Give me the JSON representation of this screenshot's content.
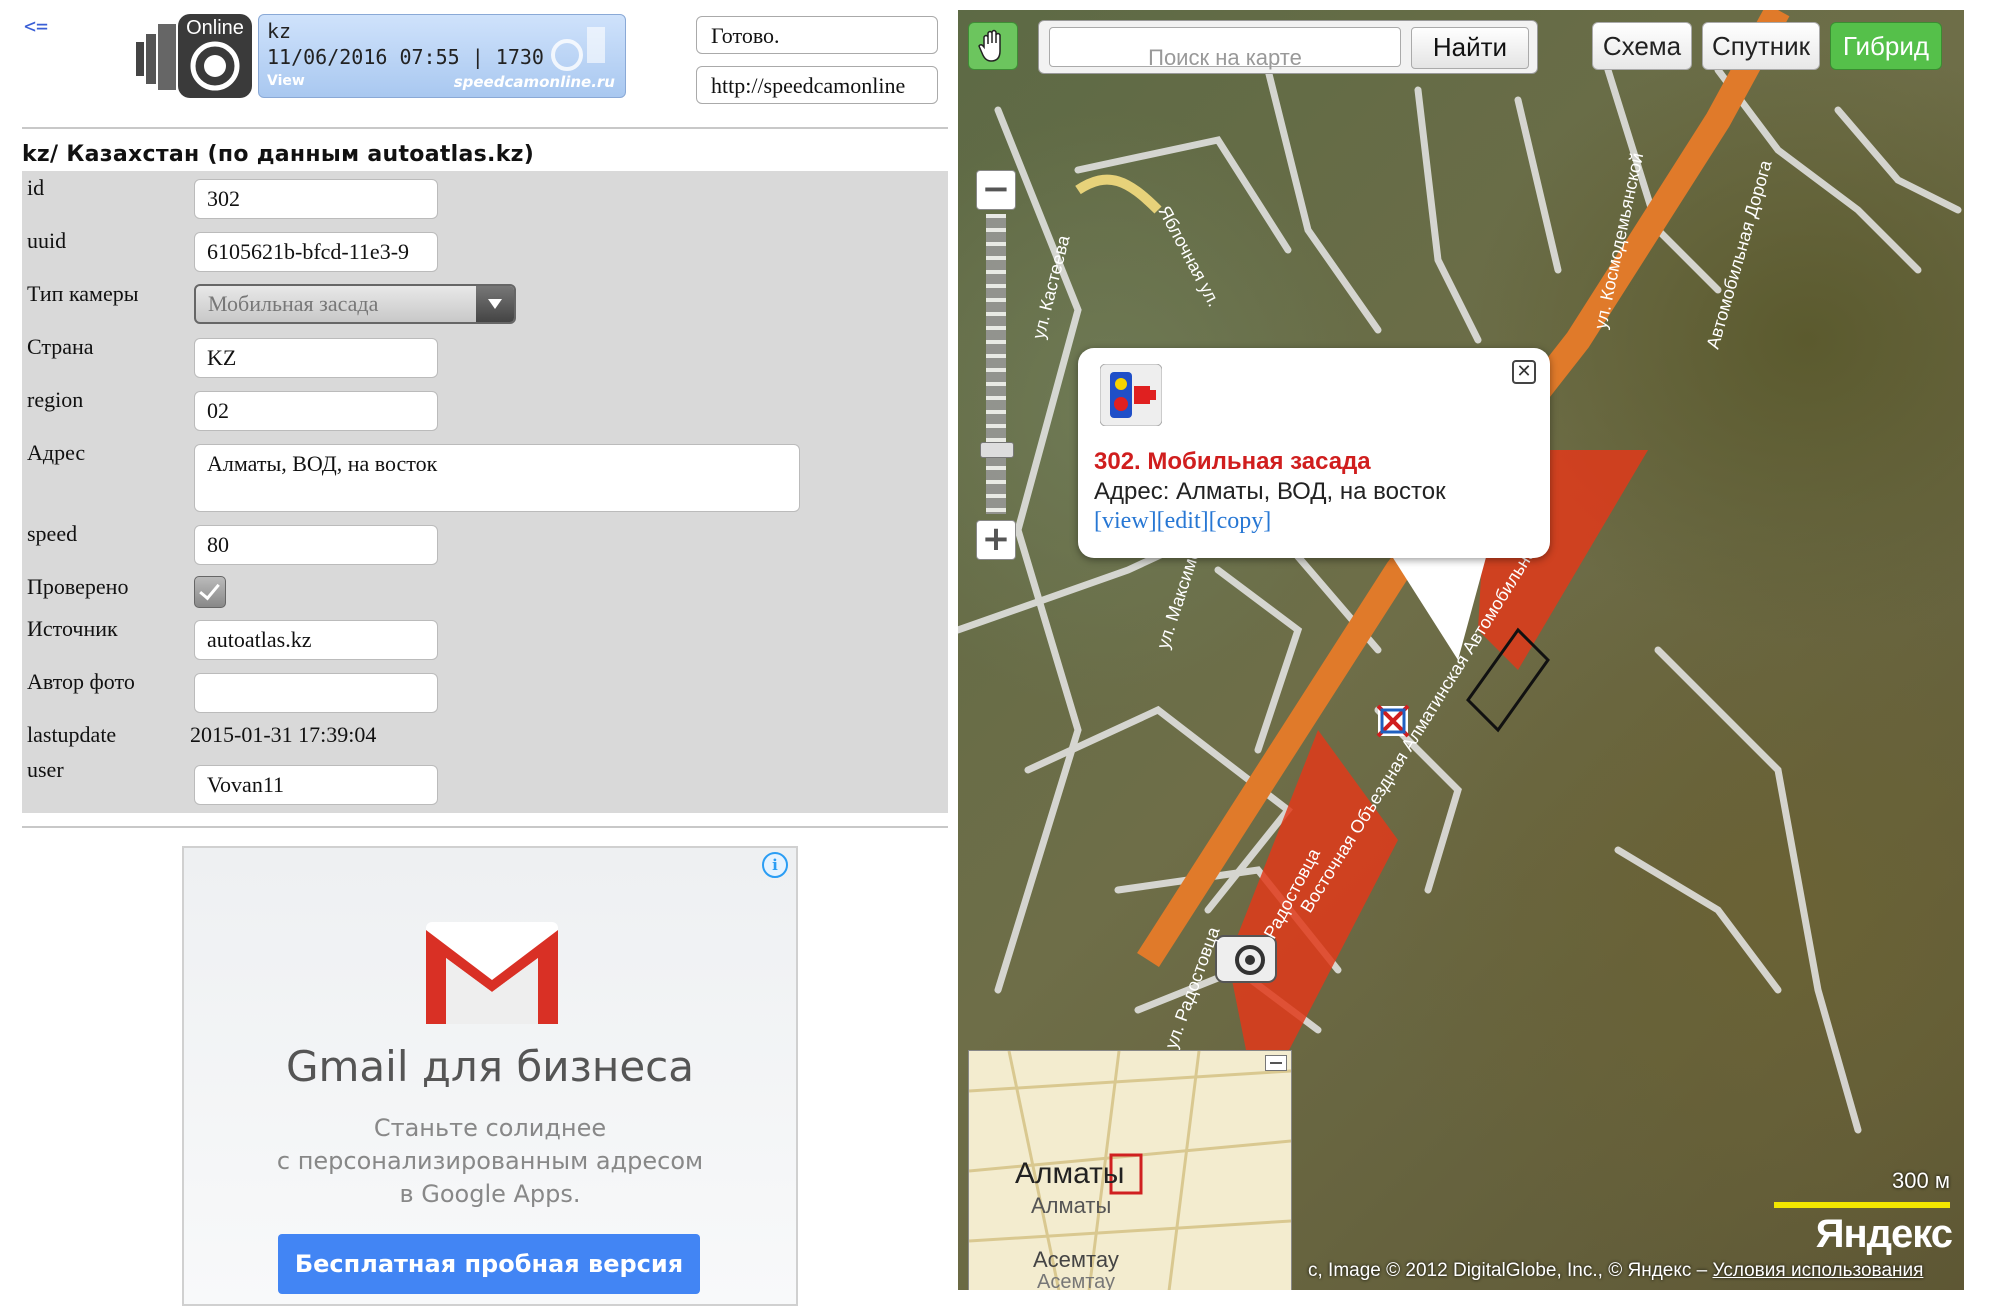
{
  "nav": {
    "back_link": "<="
  },
  "logo": {
    "text": "Online"
  },
  "ticker": {
    "line1": "kz",
    "line2": "11/06/2016 07:55 | 1730",
    "line3": "View",
    "site": "speedcamonline.ru"
  },
  "status_box": "Готово.",
  "url_box": "http://speedcamonline",
  "section_title": "kz/ Казахстан (по данным autoatlas.kz)",
  "form": {
    "id_label": "id",
    "id_value": "302",
    "uuid_label": "uuid",
    "uuid_value": "6105621b-bfcd-11e3-9",
    "type_label": "Тип камеры",
    "type_value": "Мобильная засада",
    "country_label": "Страна",
    "country_value": "KZ",
    "region_label": "region",
    "region_value": "02",
    "address_label": "Адрес",
    "address_value": "Алматы, ВОД, на восток",
    "speed_label": "speed",
    "speed_value": "80",
    "verified_label": "Проверено",
    "verified_checked": true,
    "source_label": "Источник",
    "source_value": "autoatlas.kz",
    "photo_author_label": "Автор фото",
    "photo_author_value": "",
    "lastupdate_label": "lastupdate",
    "lastupdate_value": "2015-01-31 17:39:04",
    "user_label": "user",
    "user_value": "Vovan11"
  },
  "ad": {
    "info_icon": "i",
    "title": "Gmail для бизнеса",
    "text_line1": "Станьте солиднее",
    "text_line2": "с персонализированным адресом",
    "text_line3": "в Google Apps.",
    "button": "Бесплатная пробная версия",
    "colors": {
      "button": "#4285f4",
      "logo_red": "#d93025"
    }
  },
  "map": {
    "search_placeholder": "Поиск на карте",
    "search_button": "Найти",
    "mode_scheme": "Схема",
    "mode_satellite": "Спутник",
    "mode_hybrid": "Гибрид",
    "zoom_minus": "−",
    "zoom_plus": "+",
    "balloon": {
      "title": "302. Мобильная засада",
      "address": "Адрес: Алматы, ВОД, на восток",
      "links": "[view][edit][copy]",
      "close": "✕"
    },
    "streets": {
      "s1": "ул. Кастеева",
      "s2": "Яблочная ул.",
      "s3": "ул. Космодемьянской",
      "s4": "Автомобильная Дорога",
      "s5": "ул. Максимова",
      "s6": "Восточная Объездная Алматинская Автомобильная",
      "s7": "ул. Радостовца",
      "s8": "Радостовца"
    },
    "minimap": {
      "city": "Алматы",
      "city_sub": "Алматы",
      "town": "Асемтау",
      "town_sub": "Асемтау"
    },
    "scale": "300 м",
    "brand": "Яндекс",
    "copyright": "c, Image © 2012 DigitalGlobe, Inc., © Яндекс –",
    "terms_link": "Условия использования",
    "colors": {
      "hybrid_active": "#55c04a",
      "balloon_title": "#d01e1e",
      "scale_bar": "#f2e600"
    }
  }
}
